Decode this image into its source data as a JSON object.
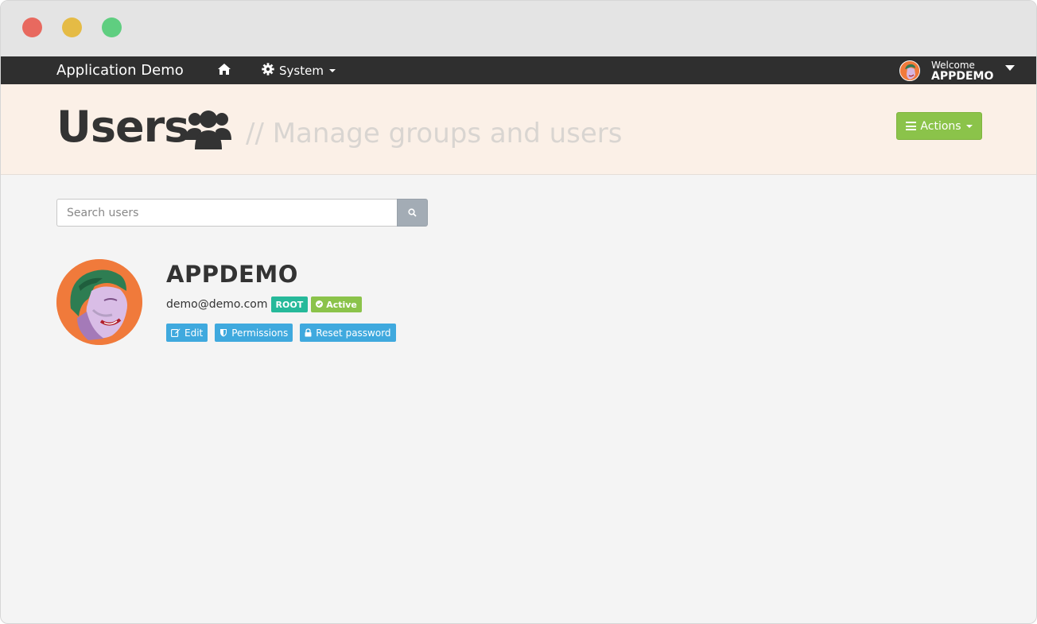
{
  "navbar": {
    "brand": "Application Demo",
    "home_icon": "home-icon",
    "system_label": "System",
    "welcome_label": "Welcome",
    "username": "APPDEMO"
  },
  "header": {
    "title": "Users",
    "title_icon": "users-icon",
    "subtitle": "// Manage groups and users",
    "actions_label": "Actions"
  },
  "search": {
    "placeholder": "Search users",
    "value": ""
  },
  "user": {
    "name": "APPDEMO",
    "email": "demo@demo.com",
    "role_badge": "ROOT",
    "status_badge": "Active",
    "buttons": {
      "edit": "Edit",
      "permissions": "Permissions",
      "reset_password": "Reset password"
    }
  },
  "colors": {
    "navbar_bg": "#2f2f2f",
    "header_bg": "#fbf0e7",
    "actions_green": "#8bc34a",
    "root_badge": "#26b99a",
    "button_blue": "#3fa9de",
    "avatar_orange": "#f07a3b"
  }
}
